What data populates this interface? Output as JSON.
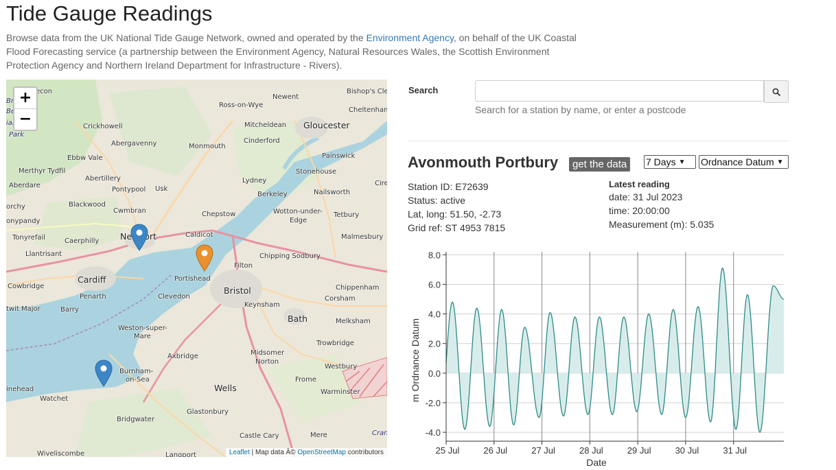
{
  "page": {
    "title": "Tide Gauge Readings",
    "intro_before": "Browse data from the UK National Tide Gauge Network, owned and operated by the ",
    "intro_link": "Environment Agency",
    "intro_after": ", on behalf of the UK Coastal Flood Forecasting service (a partnership between the Environment Agency, Natural Resources Wales, the Scottish Environment Protection Agency and Northern Ireland Department for Infrastructure - Rivers)."
  },
  "map": {
    "zoom_in": "+",
    "zoom_out": "−",
    "attribution": {
      "leaflet": "Leaflet",
      "sep": " | Map data Â© ",
      "osm": "OpenStreetMap",
      "suffix": " contributors"
    },
    "marker_colors": {
      "default": "#3d86c6",
      "selected": "#e8912d"
    },
    "labels": {
      "brecon": "econ",
      "brec": "Brec",
      "be": "Be",
      "ial": "ial",
      "park": "Park",
      "newent": "Newent",
      "bishops": "Bishop's Clee",
      "rosswye": "Ross-on-Wye",
      "cheltenham": "Cheltenham",
      "crickhowell": "Crickhowell",
      "mitcheldean": "Mitcheldean",
      "gloucester": "Gloucester",
      "abergavenny": "Abergavenny",
      "cinderford": "Cinderford",
      "monmouth": "Monmouth",
      "ebbwvale": "Ebbw Vale",
      "painswick": "Painswick",
      "merthyr": "Merthyr Tydfil",
      "stonehouse": "Stonehouse",
      "abertillery": "Abertillery",
      "lydney": "Lydney",
      "aberdare": "Aberdare",
      "pontypool": "Pontypool",
      "usk": "Usk",
      "cire": "Cire",
      "nailsworth": "Nailsworth",
      "berkeley": "Berkeley",
      "blackwood": "Blackwood",
      "orchy": "orchy",
      "cwmbran": "Cwmbran",
      "chepstow": "Chepstow",
      "wotton": "Wotton-under-",
      "edge": "Edge",
      "tetbury": "Tetbury",
      "onypandy": "onypandy",
      "newport": "Newport",
      "tonyrefail": "Tonyrefail",
      "caerphilly": "Caerphilly",
      "caldicot": "Caldicot",
      "malmesbury": "Malmesbury",
      "llantrisant": "Llantrisant",
      "chipping": "Chipping Sodbury",
      "filton": "Filton",
      "cardiff": "Cardiff",
      "portishead": "Portishead",
      "chippenham": "Chippenham",
      "cowbridge": "Cowbridge",
      "penarth": "Penarth",
      "clevedon": "Clevedon",
      "bristol": "Bristol",
      "corsham": "Corsham",
      "keynsham": "Keynsham",
      "barry": "Barry",
      "twitmajor": "twit Major",
      "bath": "Bath",
      "melksham": "Melksham",
      "weston1": "Weston-super-",
      "weston2": "Mare",
      "trowbridge": "Trowbridge",
      "axbridge": "Axbridge",
      "midsomer": "Midsomer",
      "norton": "Norton",
      "westbury": "Westbury",
      "burnham1": "Burnham-",
      "burnham2": "on-Sea",
      "frome": "Frome",
      "inehead": "inehead",
      "wells": "Wells",
      "warminster": "Warminster",
      "watchet": "Watchet",
      "bridgwater": "Bridgwater",
      "glastonbury": "Glastonbury",
      "castlecary": "Castle Cary",
      "mere": "Mere",
      "cran": "Cran",
      "wiveliscombe": "Wiveliscombe",
      "langport": "Langport"
    }
  },
  "search": {
    "label": "Search",
    "value": "",
    "placeholder": "",
    "help": "Search for a station by name, or enter a postcode"
  },
  "station": {
    "name": "Avonmouth Portbury",
    "get_data_label": "get the data",
    "period": "7 Days",
    "datum": "Ordnance Datum",
    "id_line": "Station ID: E72639",
    "status_line": "Status: active",
    "latlong_line": "Lat, long: 51.50, -2.73",
    "grid_line": "Grid ref: ST 4953 7815",
    "latest_heading": "Latest reading",
    "latest_date": "date: 31 Jul 2023",
    "latest_time": "time: 20:00:00",
    "latest_measure": "Measurement (m): 5.035"
  },
  "chart_data": {
    "type": "area",
    "xlabel": "Date",
    "ylabel": "m Ordnance Datum",
    "ylim": [
      -4.6,
      8.2
    ],
    "yticks": [
      -4.0,
      -2.0,
      0.0,
      2.0,
      4.0,
      6.0,
      8.0
    ],
    "ytick_labels": [
      "-4.0",
      "-2.0",
      "0.0",
      "2.0",
      "4.0",
      "6.0",
      "8.0"
    ],
    "xlim_days": [
      0.0,
      7.05
    ],
    "xticks": [
      0,
      1,
      2,
      3,
      4,
      5,
      6
    ],
    "xtick_labels": [
      "25 Jul",
      "26 Jul",
      "27 Jul",
      "28 Jul",
      "29 Jul",
      "30 Jul",
      "31 Jul"
    ],
    "grid": true,
    "colors": {
      "line": "#2e8a87",
      "fill": "#d6ecea"
    },
    "highs": [
      [
        0.13,
        4.8
      ],
      [
        0.64,
        4.4
      ],
      [
        1.16,
        4.3
      ],
      [
        1.64,
        3.1
      ],
      [
        2.17,
        4.1
      ],
      [
        2.69,
        3.8
      ],
      [
        3.2,
        3.8
      ],
      [
        3.71,
        3.8
      ],
      [
        4.23,
        4.0
      ],
      [
        4.74,
        4.3
      ],
      [
        5.26,
        4.5
      ],
      [
        5.77,
        7.1
      ],
      [
        6.29,
        5.3
      ],
      [
        6.83,
        5.9
      ],
      [
        7.05,
        5.0
      ]
    ],
    "lows": [
      [
        -0.12,
        -3.0
      ],
      [
        0.39,
        -3.8
      ],
      [
        0.91,
        -3.6
      ],
      [
        1.41,
        -3.5
      ],
      [
        1.94,
        -3.0
      ],
      [
        2.45,
        -2.9
      ],
      [
        2.96,
        -2.8
      ],
      [
        3.47,
        -2.8
      ],
      [
        3.98,
        -2.6
      ],
      [
        4.5,
        -2.8
      ],
      [
        5.0,
        -3.0
      ],
      [
        5.52,
        -3.3
      ],
      [
        6.05,
        -3.8
      ],
      [
        6.55,
        -4.0
      ]
    ]
  }
}
